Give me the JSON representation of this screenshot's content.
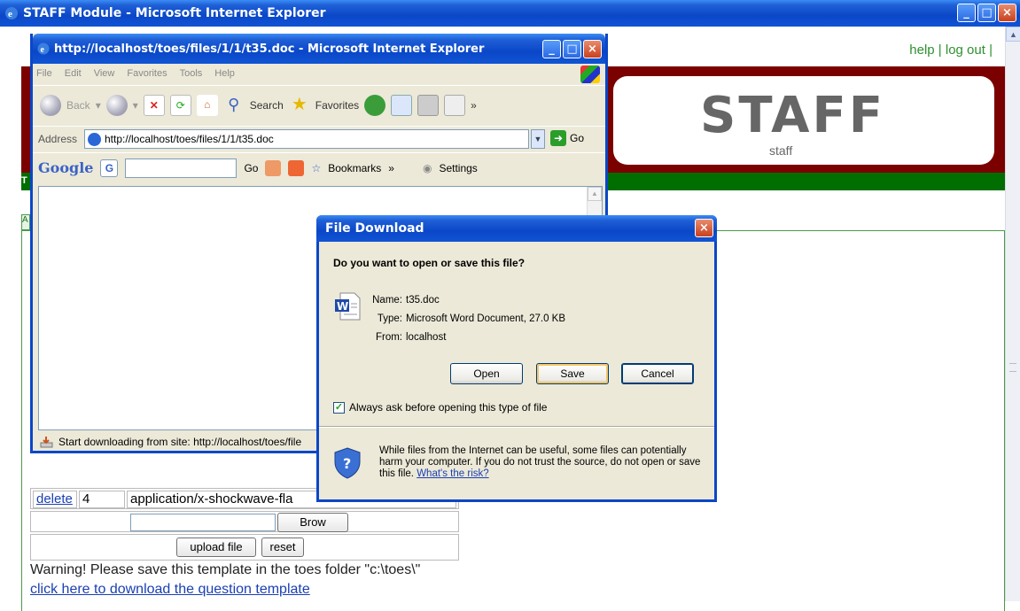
{
  "outer_window": {
    "title": "STAFF Module - Microsoft Internet Explorer",
    "header_links": {
      "help": "help",
      "separator": "|",
      "logout": "log out",
      "trailing_separator": "|"
    },
    "logo": {
      "big": "STAFF",
      "small": "staff"
    },
    "green_band_letter": "T",
    "tab_letter": "A",
    "file_table": {
      "delete_row": {
        "action": "delete",
        "id": "4",
        "mime": "application/x-shockwave-fla"
      },
      "browse_button": "Brow",
      "upload_button": "upload file",
      "reset_button": "reset"
    },
    "warning_text": "Warning! Please save this template in the toes folder \"c:\\toes\\\"",
    "download_link": "click here to download the question template"
  },
  "inner_window": {
    "title": "http://localhost/toes/files/1/1/t35.doc - Microsoft Internet Explorer",
    "menu": [
      "File",
      "Edit",
      "View",
      "Favorites",
      "Tools",
      "Help"
    ],
    "toolbar": {
      "back": "Back",
      "search": "Search",
      "favorites": "Favorites",
      "more": "»"
    },
    "address": {
      "label": "Address",
      "url": "http://localhost/toes/files/1/1/t35.doc",
      "go": "Go"
    },
    "google_bar": {
      "logo": "Google",
      "go": "Go",
      "bookmarks": "Bookmarks",
      "more": "»",
      "settings": "Settings"
    },
    "status": "Start downloading from site: http://localhost/toes/file"
  },
  "dialog": {
    "title": "File Download",
    "question": "Do you want to open or save this file?",
    "name_label": "Name:",
    "name_value": "t35.doc",
    "type_label": "Type:",
    "type_value": "Microsoft Word Document, 27.0 KB",
    "from_label": "From:",
    "from_value": "localhost",
    "open": "Open",
    "save": "Save",
    "cancel": "Cancel",
    "always_ask": "Always ask before opening this type of file",
    "always_ask_checked": true,
    "warning": "While files from the Internet can be useful, some files can potentially harm your computer. If you do not trust the source, do not open or save this file.",
    "risk_link": "What's the risk?"
  },
  "colors": {
    "xp_blue": "#0a47c8",
    "header_red": "#7b0000",
    "green": "#006e00",
    "dialog_bg": "#ece9d8"
  }
}
